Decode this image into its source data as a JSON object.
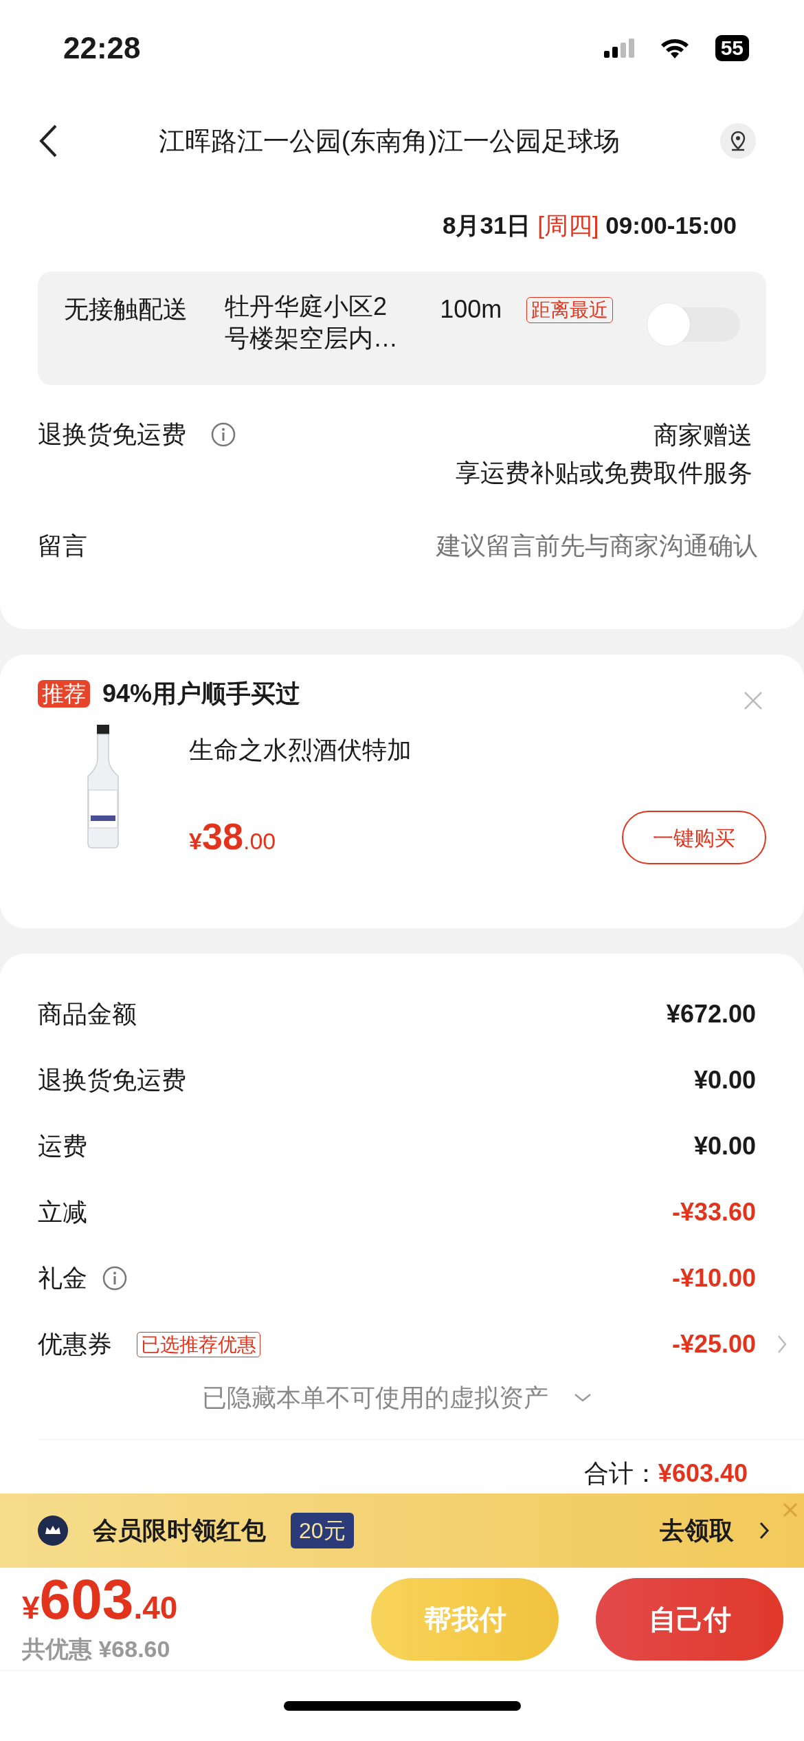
{
  "status_bar": {
    "time": "22:28",
    "battery": "55"
  },
  "header": {
    "title": "江晖路江一公园(东南角)江一公园足球场"
  },
  "delivery": {
    "date": "8月31日",
    "weekday": "[周四]",
    "time_range": "09:00-15:00"
  },
  "contactless": {
    "label": "无接触配送",
    "address": "牡丹华庭小区2号楼架空层内…",
    "distance": "100m",
    "tag": "距离最近",
    "on": false
  },
  "return_policy": {
    "label": "退换货免运费",
    "value": "商家赠送",
    "note": "享运费补贴或免费取件服务"
  },
  "message": {
    "label": "留言",
    "placeholder": "建议留言前先与商家沟通确认"
  },
  "recommend": {
    "badge": "推荐",
    "headline": "94%用户顺手买过",
    "product": {
      "name": "生命之水烈酒伏特加",
      "currency": "¥",
      "price_int": "38",
      "price_dec": ".00"
    },
    "button": "一键购买"
  },
  "summary": {
    "rows": [
      {
        "label": "商品金额",
        "value": "¥672.00",
        "kind": "plain",
        "info": false,
        "chevron": false
      },
      {
        "label": "退换货免运费",
        "value": "¥0.00",
        "kind": "plain",
        "info": false,
        "chevron": false
      },
      {
        "label": "运费",
        "value": "¥0.00",
        "kind": "plain",
        "info": false,
        "chevron": false
      },
      {
        "label": "立减",
        "value": "-¥33.60",
        "kind": "discount",
        "info": false,
        "chevron": false
      },
      {
        "label": "礼金",
        "value": "-¥10.00",
        "kind": "discount",
        "info": true,
        "chevron": false
      },
      {
        "label": "优惠券",
        "tag": "已选推荐优惠",
        "value": "-¥25.00",
        "kind": "discount",
        "info": false,
        "chevron": true
      }
    ],
    "hidden_note": "已隐藏本单不可使用的虚拟资产",
    "total_label": "合计：",
    "total": "¥603.40"
  },
  "banner": {
    "text": "会员限时领红包",
    "amount": "20元",
    "action": "去领取"
  },
  "bottom": {
    "currency": "¥",
    "price_int": "603",
    "price_dec": ".40",
    "saved": "共优惠 ¥68.60",
    "buttons": [
      {
        "label": "帮我付",
        "kind": "helper"
      },
      {
        "label": "自己付",
        "kind": "primary"
      }
    ]
  }
}
